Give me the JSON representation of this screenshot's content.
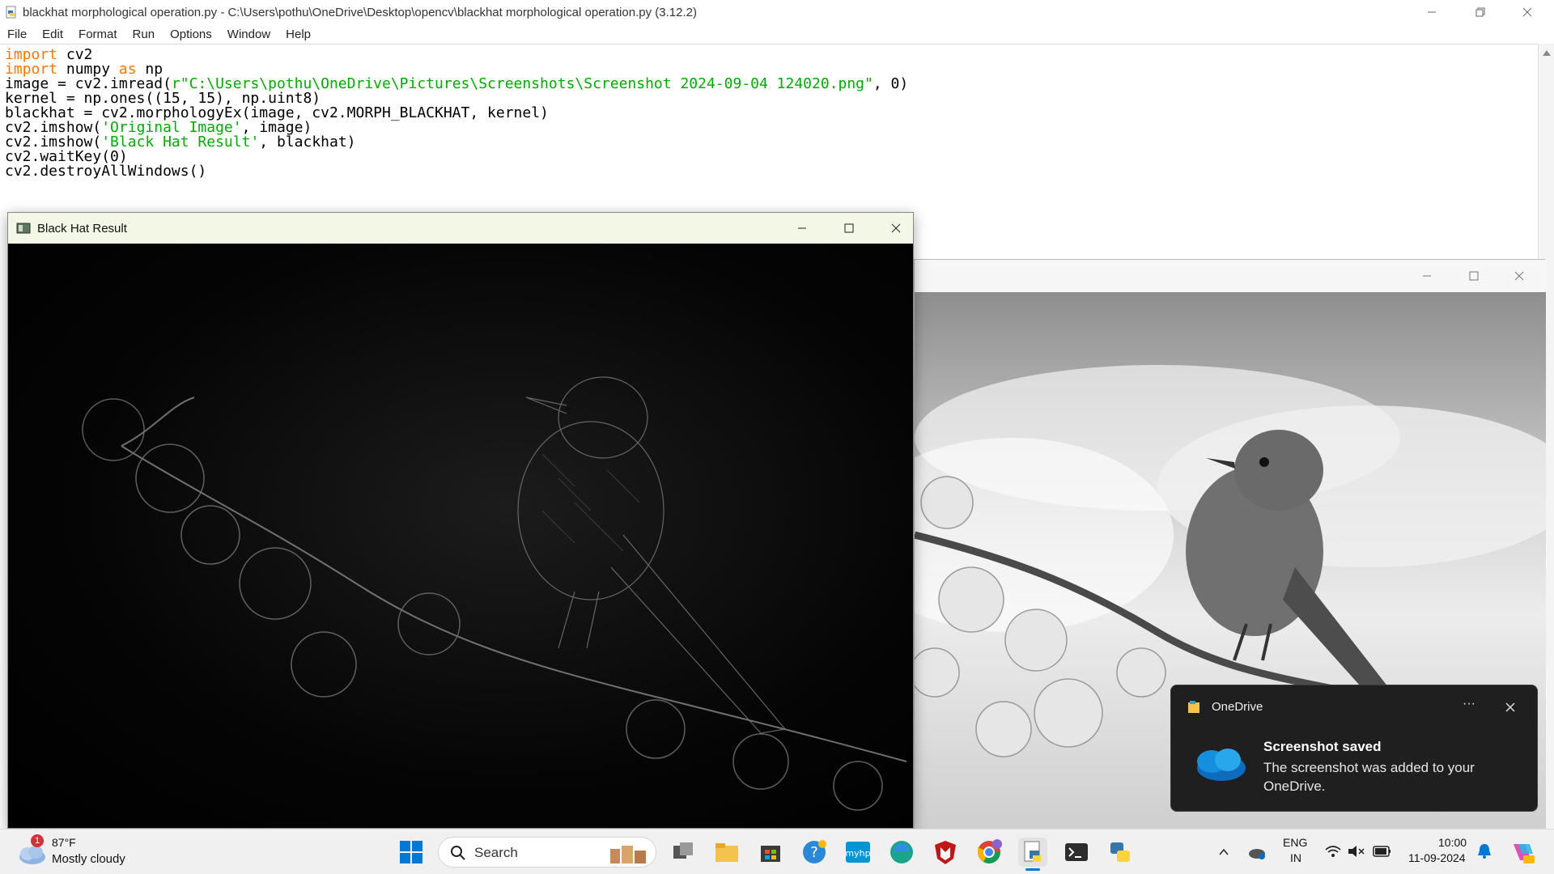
{
  "editor": {
    "title": "blackhat morphological operation.py - C:\\Users\\pothu\\OneDrive\\Desktop\\opencv\\blackhat morphological operation.py (3.12.2)",
    "menu": [
      "File",
      "Edit",
      "Format",
      "Run",
      "Options",
      "Window",
      "Help"
    ],
    "code": {
      "l1": {
        "kw": "import",
        "rest": " cv2"
      },
      "l2": {
        "kw": "import",
        "mid": " numpy ",
        "kw2": "as",
        "rest": " np"
      },
      "l3": {
        "pre": "image = cv2.imread(",
        "str": "r\"C:\\Users\\pothu\\OneDrive\\Pictures\\Screenshots\\Screenshot 2024-09-04 124020.png\"",
        "post": ", 0)"
      },
      "l4": "kernel = np.ones((15, 15), np.uint8)",
      "l5": "blackhat = cv2.morphologyEx(image, cv2.MORPH_BLACKHAT, kernel)",
      "l6": {
        "pre": "cv2.imshow(",
        "str": "'Original Image'",
        "post": ", image)"
      },
      "l7": {
        "pre": "cv2.imshow(",
        "str": "'Black Hat Result'",
        "post": ", blackhat)"
      },
      "l8": "cv2.waitKey(0)",
      "l9": "cv2.destroyAllWindows()"
    }
  },
  "blackhat_window": {
    "title": "Black Hat Result"
  },
  "toast": {
    "app": "OneDrive",
    "more": "···",
    "heading": "Screenshot saved",
    "body": "The screenshot was added to your OneDrive."
  },
  "taskbar": {
    "weather_badge": "1",
    "temperature": "87°F",
    "weather_desc": "Mostly cloudy",
    "search_label": "Search",
    "lang_line1": "ENG",
    "lang_line2": "IN",
    "time": "10:00",
    "date": "11-09-2024"
  },
  "colors": {
    "keyword": "#ff7700",
    "string": "#00aa00",
    "toast_bg": "#1f1f1f",
    "onedrive_blue": "#0f6cbd"
  }
}
